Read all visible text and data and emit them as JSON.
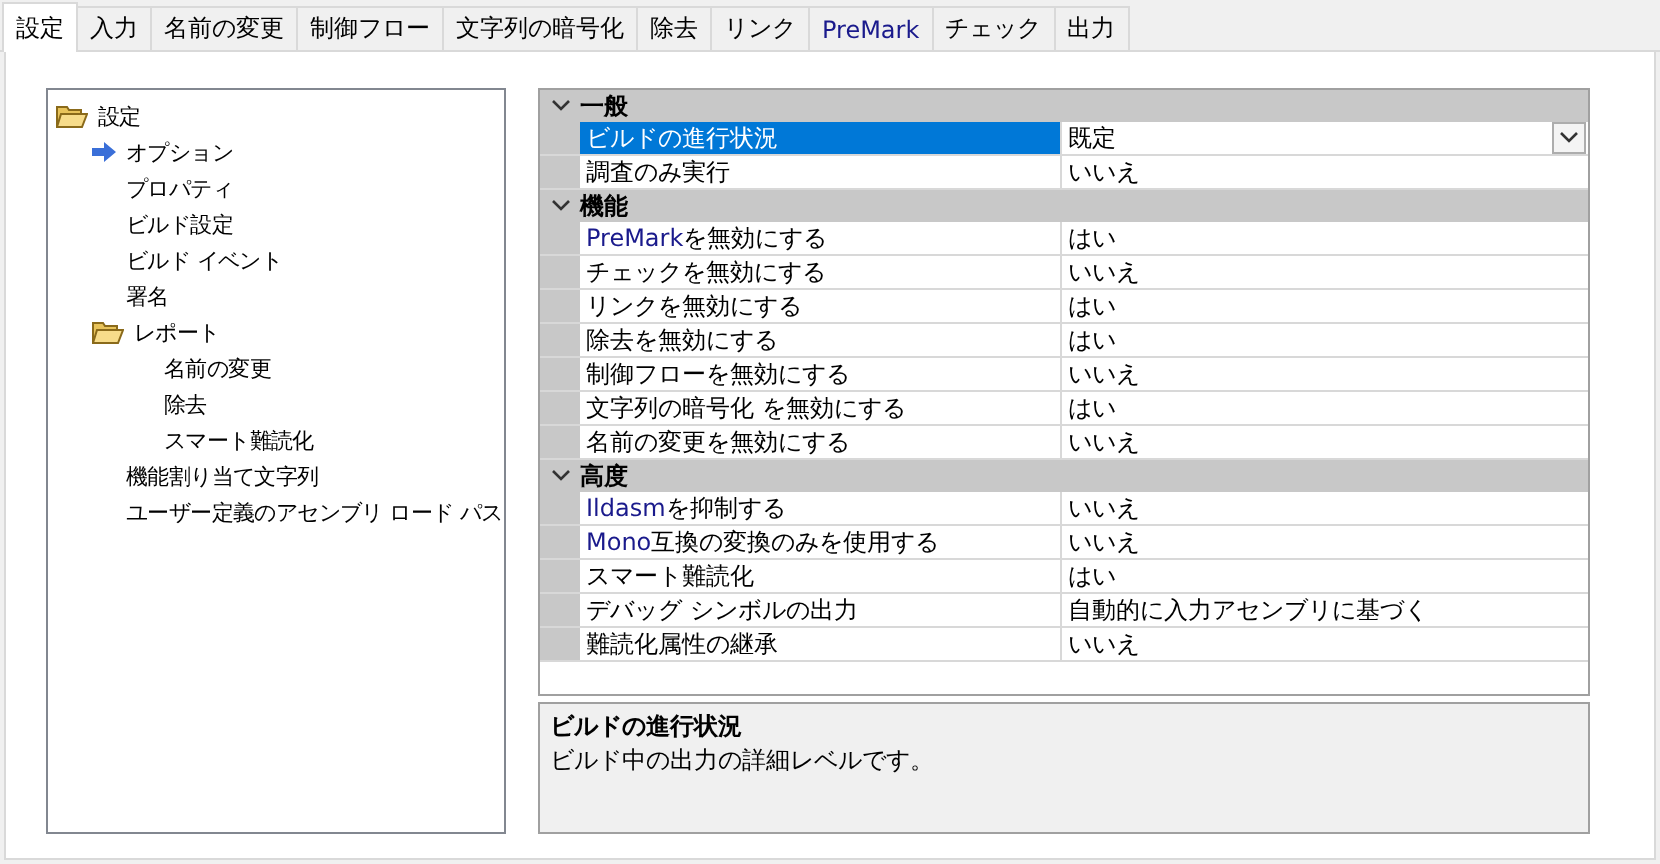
{
  "tabs": [
    {
      "label": "設定",
      "selected": true,
      "accent": false
    },
    {
      "label": "入力",
      "selected": false,
      "accent": false
    },
    {
      "label": "名前の変更",
      "selected": false,
      "accent": false
    },
    {
      "label": "制御フロー",
      "selected": false,
      "accent": false
    },
    {
      "label": "文字列の暗号化",
      "selected": false,
      "accent": false
    },
    {
      "label": "除去",
      "selected": false,
      "accent": false
    },
    {
      "label": "リンク",
      "selected": false,
      "accent": false
    },
    {
      "label": "PreMark",
      "selected": false,
      "accent": true
    },
    {
      "label": "チェック",
      "selected": false,
      "accent": false
    },
    {
      "label": "出力",
      "selected": false,
      "accent": false
    }
  ],
  "tree": [
    {
      "label": "設定",
      "kind": "folder",
      "selected": false,
      "children": [
        {
          "label": "オプション",
          "kind": "item",
          "selected": true
        },
        {
          "label": "プロパティ",
          "kind": "item",
          "selected": false
        },
        {
          "label": "ビルド設定",
          "kind": "item",
          "selected": false
        },
        {
          "label": "ビルド イベント",
          "kind": "item",
          "selected": false
        },
        {
          "label": "署名",
          "kind": "item",
          "selected": false
        },
        {
          "label": "レポート",
          "kind": "folder",
          "selected": false,
          "children": [
            {
              "label": "名前の変更",
              "kind": "item",
              "selected": false
            },
            {
              "label": "除去",
              "kind": "item",
              "selected": false
            },
            {
              "label": "スマート難読化",
              "kind": "item",
              "selected": false
            }
          ]
        },
        {
          "label": "機能割り当て文字列",
          "kind": "item",
          "selected": false
        },
        {
          "label": "ユーザー定義のアセンブリ ロード パス",
          "kind": "item",
          "selected": false
        }
      ]
    }
  ],
  "properties": [
    {
      "category": "一般",
      "expanded": true,
      "rows": [
        {
          "name": "ビルドの進行状況",
          "value": "既定",
          "selected": true
        },
        {
          "name": "調査のみ実行",
          "value": "いいえ",
          "selected": false
        }
      ]
    },
    {
      "category": "機能",
      "expanded": true,
      "rows": [
        {
          "prefix": "PreMark",
          "name": " を無効にする",
          "value": "はい",
          "selected": false
        },
        {
          "name": "チェックを無効にする",
          "value": "いいえ",
          "selected": false
        },
        {
          "name": "リンクを無効にする",
          "value": "はい",
          "selected": false
        },
        {
          "name": "除去を無効にする",
          "value": "はい",
          "selected": false
        },
        {
          "name": "制御フローを無効にする",
          "value": "いいえ",
          "selected": false
        },
        {
          "name": "文字列の暗号化 を無効にする",
          "value": "はい",
          "selected": false
        },
        {
          "name": "名前の変更を無効にする",
          "value": "いいえ",
          "selected": false
        }
      ]
    },
    {
      "category": "高度",
      "expanded": true,
      "rows": [
        {
          "prefix": "Ildasm",
          "name": " を抑制する",
          "value": "いいえ",
          "selected": false
        },
        {
          "prefix": "Mono",
          "name": " 互換の変換のみを使用する",
          "value": "いいえ",
          "selected": false
        },
        {
          "name": "スマート難読化",
          "value": "はい",
          "selected": false
        },
        {
          "name": "デバッグ シンボルの出力",
          "value": "自動的に入力アセンブリに基づく",
          "selected": false
        },
        {
          "name": "難読化属性の継承",
          "value": "いいえ",
          "selected": false
        }
      ]
    }
  ],
  "description": {
    "title": "ビルドの進行状況",
    "text": "ビルド中の出力の詳細レベルです。"
  }
}
